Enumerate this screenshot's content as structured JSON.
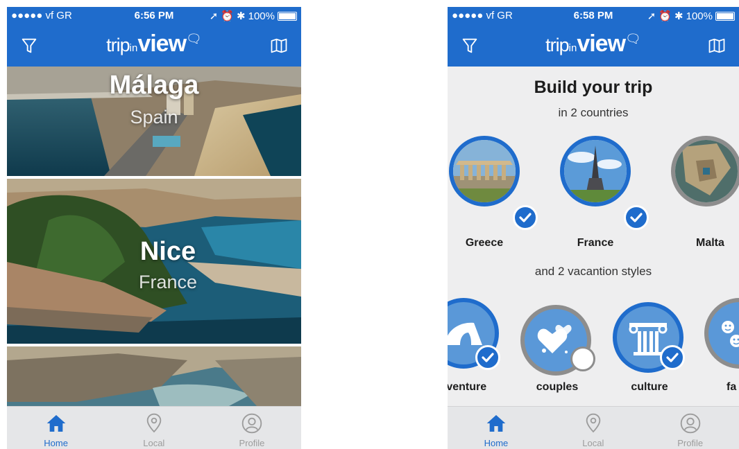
{
  "screens": {
    "left": {
      "status": {
        "carrier": "●●●●● vf GR",
        "time": "6:56 PM",
        "battery": "100%"
      },
      "logo": {
        "part1": "trip",
        "part2": "in",
        "part3": "view"
      },
      "destinations": [
        {
          "city": "Málaga",
          "country": "Spain"
        },
        {
          "city": "Nice",
          "country": "France"
        },
        {
          "city": "",
          "country": ""
        }
      ],
      "tabs": [
        {
          "label": "Home",
          "icon": "home-icon",
          "active": true
        },
        {
          "label": "Local",
          "icon": "location-pin-icon",
          "active": false
        },
        {
          "label": "Profile",
          "icon": "profile-icon",
          "active": false
        }
      ]
    },
    "right": {
      "status": {
        "carrier": "●●●●● vf GR",
        "time": "6:58 PM",
        "battery": "100%"
      },
      "logo": {
        "part1": "trip",
        "part2": "in",
        "part3": "view"
      },
      "title": "Build your trip",
      "countries_line": "in 2 countries",
      "countries": [
        {
          "label": "Greece",
          "selected": true
        },
        {
          "label": "France",
          "selected": true
        },
        {
          "label": "Malta",
          "selected": false
        }
      ],
      "styles_line": "and 2 vacantion styles",
      "styles": [
        {
          "label": "lventure",
          "icon": "tent-icon",
          "selected": true
        },
        {
          "label": "couples",
          "icon": "hearts-icon",
          "selected": false
        },
        {
          "label": "culture",
          "icon": "column-icon",
          "selected": true
        },
        {
          "label": "fa",
          "icon": "smiley-faces-icon",
          "selected": false
        }
      ],
      "tabs": [
        {
          "label": "Home",
          "icon": "home-icon",
          "active": true
        },
        {
          "label": "Local",
          "icon": "location-pin-icon",
          "active": false
        },
        {
          "label": "Profile",
          "icon": "profile-icon",
          "active": false
        }
      ]
    }
  },
  "colors": {
    "brand_blue": "#1f6ccc",
    "tab_bar": "#e5e6e8",
    "inactive_grey": "#9c9c9c"
  }
}
